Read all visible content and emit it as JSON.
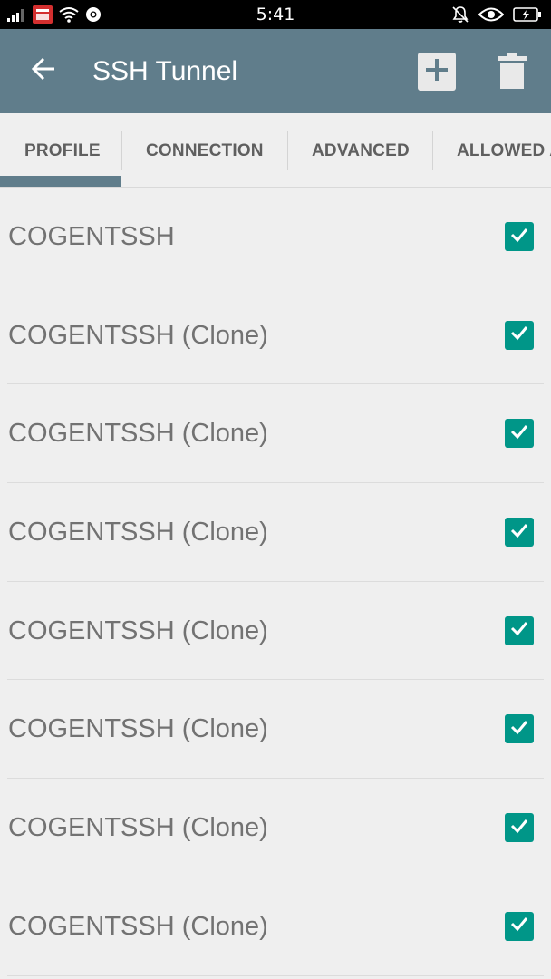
{
  "status_bar": {
    "time": "5:41"
  },
  "app_bar": {
    "title": "SSH Tunnel"
  },
  "tabs": [
    {
      "label": "PROFILE",
      "selected": true
    },
    {
      "label": "CONNECTION",
      "selected": false
    },
    {
      "label": "ADVANCED",
      "selected": false
    },
    {
      "label": "ALLOWED A",
      "selected": false
    }
  ],
  "profiles": [
    {
      "name": "COGENTSSH",
      "checked": true
    },
    {
      "name": "COGENTSSH (Clone)",
      "checked": true
    },
    {
      "name": "COGENTSSH (Clone)",
      "checked": true
    },
    {
      "name": "COGENTSSH (Clone)",
      "checked": true
    },
    {
      "name": "COGENTSSH (Clone)",
      "checked": true
    },
    {
      "name": "COGENTSSH (Clone)",
      "checked": true
    },
    {
      "name": "COGENTSSH (Clone)",
      "checked": true
    },
    {
      "name": "COGENTSSH (Clone)",
      "checked": true
    }
  ],
  "colors": {
    "app_bar": "#607d8b",
    "checkbox": "#009688",
    "background": "#efefef"
  }
}
